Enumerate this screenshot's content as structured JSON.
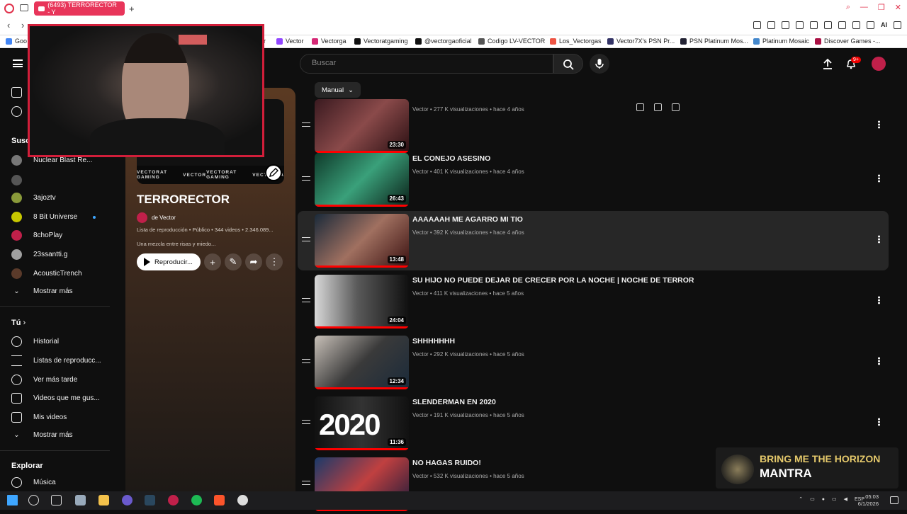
{
  "browser": {
    "tab_title": "(6493) TERRORECTOR - Y",
    "new_tab": "+",
    "bookmarks": [
      "Vector",
      "Vectorga",
      "Vectoratgaming",
      "@vectorgaoficial",
      "Codigo LV-VECTOR",
      "Los_Vectorgas",
      "Vector7X's PSN Pr...",
      "PSN Platinum Mos...",
      "Platinum Mosaic",
      "Discover Games -..."
    ]
  },
  "masthead": {
    "search_placeholder": "Buscar",
    "notifications_badge": "9+"
  },
  "sidebar": {
    "subscriptions_heading": "Susc",
    "subscriptions": [
      {
        "name": "Nuclear Blast Re...",
        "color": "#777777"
      },
      {
        "name": "",
        "color": "#555555"
      },
      {
        "name": "3ajoztv",
        "color": "#8a9a3a"
      },
      {
        "name": "8 Bit Universe",
        "color": "#c8c800",
        "live": true
      },
      {
        "name": "8choPlay",
        "color": "#c0204a"
      },
      {
        "name": "23ssantti.g",
        "color": "#a0a0a0"
      },
      {
        "name": "AcousticTrench",
        "color": "#5a3a2a"
      }
    ],
    "show_more": "Mostrar más",
    "you_heading": "Tú",
    "you_items": [
      "Historial",
      "Listas de reproducc...",
      "Ver más tarde",
      "Videos que me gus...",
      "Mis videos"
    ],
    "show_more_2": "Mostrar más",
    "explore_heading": "Explorar",
    "explore_items": [
      "Música"
    ]
  },
  "playlist": {
    "banner_labels": [
      "VECTORAT GAMING",
      "VECTOR",
      "VECTORAT GAMING",
      "VECTORGA"
    ],
    "title": "TERRORECTOR",
    "owner": "de Vector",
    "meta": "Lista de reproducción • Público • 344 videos • 2.346.089...",
    "description": "Una mezcla entre risas y miedo...",
    "play_label": "Reproducir..."
  },
  "list": {
    "sort_label": "Manual",
    "videos": [
      {
        "title": "",
        "meta": "Vector • 277 K visualizaciones • hace 4 años",
        "duration": "23:30",
        "bg": "linear-gradient(135deg,#3a1a20,#8a4a4a 50%,#2a0f12)"
      },
      {
        "title": "EL CONEJO ASESINO",
        "meta": "Vector • 401 K visualizaciones • hace 4 años",
        "duration": "26:43",
        "bg": "linear-gradient(135deg,#0f3a2a,#3aa07a 50%,#0b2018)"
      },
      {
        "title": "AAAAAAH ME AGARRO MI TIO",
        "meta": "Vector • 392 K visualizaciones • hace 4 años",
        "duration": "13:48",
        "bg": "linear-gradient(135deg,#1a2a3a,#a07060 50%,#3a1010)"
      },
      {
        "title": "SU HIJO NO PUEDE DEJAR DE CRECER POR LA NOCHE | NOCHE DE TERROR",
        "meta": "Vector • 411 K visualizaciones • hace 5 años",
        "duration": "24:04",
        "bg": "linear-gradient(90deg,#d8d8d8,#5a5a5a 45%,#101010)"
      },
      {
        "title": "SHHHHHHH",
        "meta": "Vector • 292 K visualizaciones • hace 5 años",
        "duration": "12:34",
        "bg": "linear-gradient(135deg,#c8c0b8,#3a3a3a 50%,#1a2a3a)"
      },
      {
        "title": "SLENDERMAN EN 2020",
        "meta": "Vector • 191 K visualizaciones • hace 5 años",
        "duration": "11:36",
        "bg": "linear-gradient(90deg,#111,#333 50%,#111)",
        "text": "2020"
      },
      {
        "title": "NO HAGAS RUIDO!",
        "meta": "Vector • 532 K visualizaciones • hace 5 años",
        "duration": "",
        "bg": "linear-gradient(135deg,#1a3a6a,#c04040 50%,#1a1a3a)"
      }
    ]
  },
  "now_playing": {
    "artist": "BRING ME THE HORIZON",
    "song": "MANTRA"
  },
  "taskbar": {
    "lang": "ESP",
    "time": "05:03",
    "date": "6/1/2026"
  }
}
